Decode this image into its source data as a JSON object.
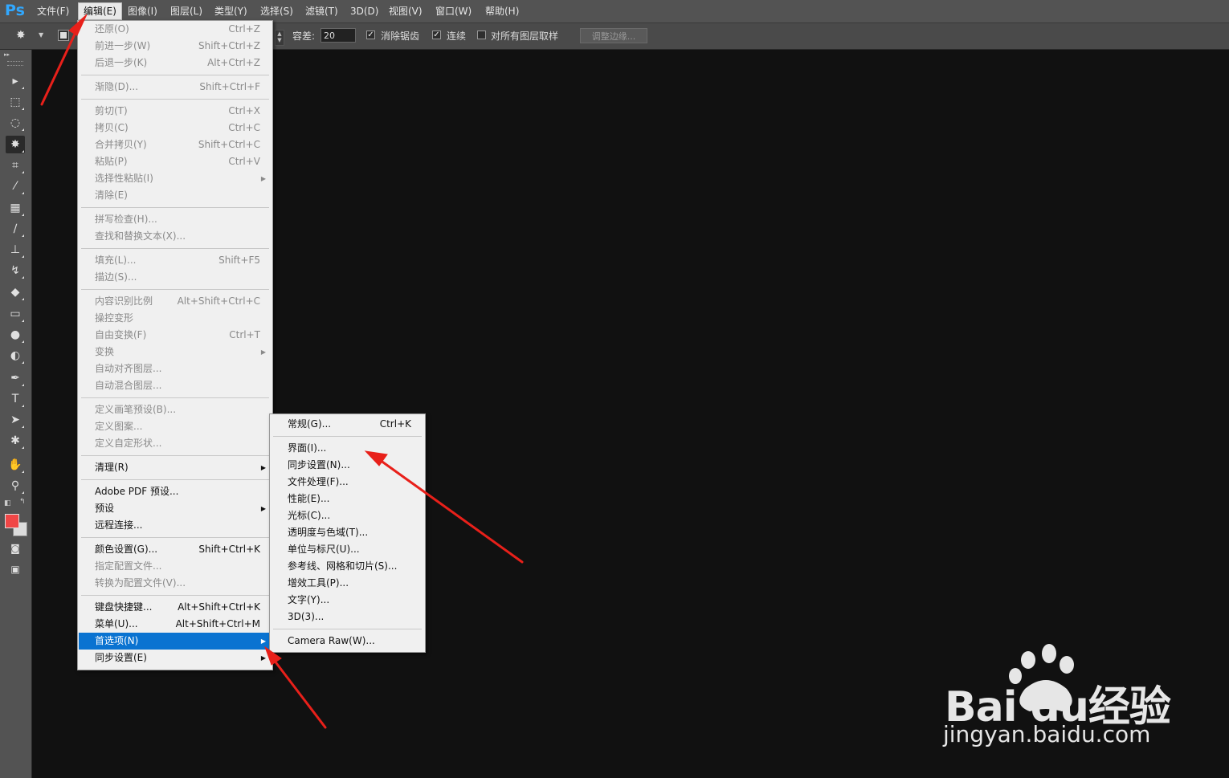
{
  "app": {
    "logo": "Ps"
  },
  "menubar": {
    "items": [
      "文件(F)",
      "编辑(E)",
      "图像(I)",
      "图层(L)",
      "类型(Y)",
      "选择(S)",
      "滤镜(T)",
      "3D(D)",
      "视图(V)",
      "窗口(W)",
      "帮助(H)"
    ],
    "active_index": 1
  },
  "options": {
    "tolerance_label": "容差:",
    "tolerance_value": "20",
    "antialias_label": "消除锯齿",
    "antialias_checked": true,
    "contiguous_label": "连续",
    "contiguous_checked": true,
    "sample_all_label": "对所有图层取样",
    "sample_all_checked": false,
    "refine_edge_label": "调整边缘..."
  },
  "edit_menu": {
    "items": [
      {
        "label": "还原(O)",
        "shortcut": "Ctrl+Z",
        "enabled": false
      },
      {
        "label": "前进一步(W)",
        "shortcut": "Shift+Ctrl+Z",
        "enabled": false
      },
      {
        "label": "后退一步(K)",
        "shortcut": "Alt+Ctrl+Z",
        "enabled": false
      },
      {
        "sep": true
      },
      {
        "label": "渐隐(D)...",
        "shortcut": "Shift+Ctrl+F",
        "enabled": false
      },
      {
        "sep": true
      },
      {
        "label": "剪切(T)",
        "shortcut": "Ctrl+X",
        "enabled": false
      },
      {
        "label": "拷贝(C)",
        "shortcut": "Ctrl+C",
        "enabled": false
      },
      {
        "label": "合并拷贝(Y)",
        "shortcut": "Shift+Ctrl+C",
        "enabled": false
      },
      {
        "label": "粘贴(P)",
        "shortcut": "Ctrl+V",
        "enabled": false
      },
      {
        "label": "选择性粘贴(I)",
        "shortcut": "",
        "enabled": false,
        "submenu": true
      },
      {
        "label": "清除(E)",
        "shortcut": "",
        "enabled": false
      },
      {
        "sep": true
      },
      {
        "label": "拼写检查(H)...",
        "shortcut": "",
        "enabled": false
      },
      {
        "label": "查找和替换文本(X)...",
        "shortcut": "",
        "enabled": false
      },
      {
        "sep": true
      },
      {
        "label": "填充(L)...",
        "shortcut": "Shift+F5",
        "enabled": false
      },
      {
        "label": "描边(S)...",
        "shortcut": "",
        "enabled": false
      },
      {
        "sep": true
      },
      {
        "label": "内容识别比例",
        "shortcut": "Alt+Shift+Ctrl+C",
        "enabled": false
      },
      {
        "label": "操控变形",
        "shortcut": "",
        "enabled": false
      },
      {
        "label": "自由变换(F)",
        "shortcut": "Ctrl+T",
        "enabled": false
      },
      {
        "label": "变换",
        "shortcut": "",
        "enabled": false,
        "submenu": true
      },
      {
        "label": "自动对齐图层...",
        "shortcut": "",
        "enabled": false
      },
      {
        "label": "自动混合图层...",
        "shortcut": "",
        "enabled": false
      },
      {
        "sep": true
      },
      {
        "label": "定义画笔预设(B)...",
        "shortcut": "",
        "enabled": false
      },
      {
        "label": "定义图案...",
        "shortcut": "",
        "enabled": false
      },
      {
        "label": "定义自定形状...",
        "shortcut": "",
        "enabled": false
      },
      {
        "sep": true
      },
      {
        "label": "清理(R)",
        "shortcut": "",
        "enabled": true,
        "submenu": true
      },
      {
        "sep": true
      },
      {
        "label": "Adobe PDF 预设...",
        "shortcut": "",
        "enabled": true
      },
      {
        "label": "预设",
        "shortcut": "",
        "enabled": true,
        "submenu": true
      },
      {
        "label": "远程连接...",
        "shortcut": "",
        "enabled": true
      },
      {
        "sep": true
      },
      {
        "label": "颜色设置(G)...",
        "shortcut": "Shift+Ctrl+K",
        "enabled": true
      },
      {
        "label": "指定配置文件...",
        "shortcut": "",
        "enabled": false
      },
      {
        "label": "转换为配置文件(V)...",
        "shortcut": "",
        "enabled": false
      },
      {
        "sep": true
      },
      {
        "label": "键盘快捷键...",
        "shortcut": "Alt+Shift+Ctrl+K",
        "enabled": true
      },
      {
        "label": "菜单(U)...",
        "shortcut": "Alt+Shift+Ctrl+M",
        "enabled": true
      },
      {
        "label": "首选项(N)",
        "shortcut": "",
        "enabled": true,
        "submenu": true,
        "highlighted": true
      },
      {
        "label": "同步设置(E)",
        "shortcut": "",
        "enabled": true,
        "submenu": true
      }
    ]
  },
  "prefs_submenu": {
    "items": [
      {
        "label": "常规(G)...",
        "shortcut": "Ctrl+K"
      },
      {
        "sep": true
      },
      {
        "label": "界面(I)..."
      },
      {
        "label": "同步设置(N)..."
      },
      {
        "label": "文件处理(F)..."
      },
      {
        "label": "性能(E)..."
      },
      {
        "label": "光标(C)..."
      },
      {
        "label": "透明度与色域(T)..."
      },
      {
        "label": "单位与标尺(U)..."
      },
      {
        "label": "参考线、网格和切片(S)..."
      },
      {
        "label": "增效工具(P)..."
      },
      {
        "label": "文字(Y)..."
      },
      {
        "label": "3D(3)..."
      },
      {
        "sep": true
      },
      {
        "label": "Camera Raw(W)..."
      }
    ]
  },
  "tools": [
    {
      "icon": "move-icon",
      "glyph": "▸"
    },
    {
      "icon": "marquee-icon",
      "glyph": "⬚"
    },
    {
      "icon": "lasso-icon",
      "glyph": "◌"
    },
    {
      "icon": "magic-wand-icon",
      "glyph": "✸",
      "selected": true
    },
    {
      "icon": "crop-icon",
      "glyph": "⌗"
    },
    {
      "icon": "eyedropper-icon",
      "glyph": "⁄"
    },
    {
      "icon": "healing-brush-icon",
      "glyph": "▦"
    },
    {
      "icon": "brush-icon",
      "glyph": "∕"
    },
    {
      "icon": "clone-stamp-icon",
      "glyph": "⊥"
    },
    {
      "icon": "history-brush-icon",
      "glyph": "↯"
    },
    {
      "icon": "eraser-icon",
      "glyph": "◆"
    },
    {
      "icon": "gradient-icon",
      "glyph": "▭"
    },
    {
      "icon": "blur-icon",
      "glyph": "●"
    },
    {
      "icon": "dodge-icon",
      "glyph": "◐"
    },
    {
      "icon": "pen-icon",
      "glyph": "✒"
    },
    {
      "icon": "type-icon",
      "glyph": "T"
    },
    {
      "icon": "path-selection-icon",
      "glyph": "➤"
    },
    {
      "icon": "shape-icon",
      "glyph": "✱"
    },
    {
      "icon": "hand-icon",
      "glyph": "✋"
    },
    {
      "icon": "zoom-icon",
      "glyph": "⚲"
    }
  ],
  "colors": {
    "foreground": "#f04646",
    "background": "#dcdcdc",
    "highlight": "#0a73d1",
    "annotation_arrow": "#e8201a"
  },
  "watermark": {
    "brand": "Bai du经验",
    "url": "jingyan.baidu.com"
  }
}
